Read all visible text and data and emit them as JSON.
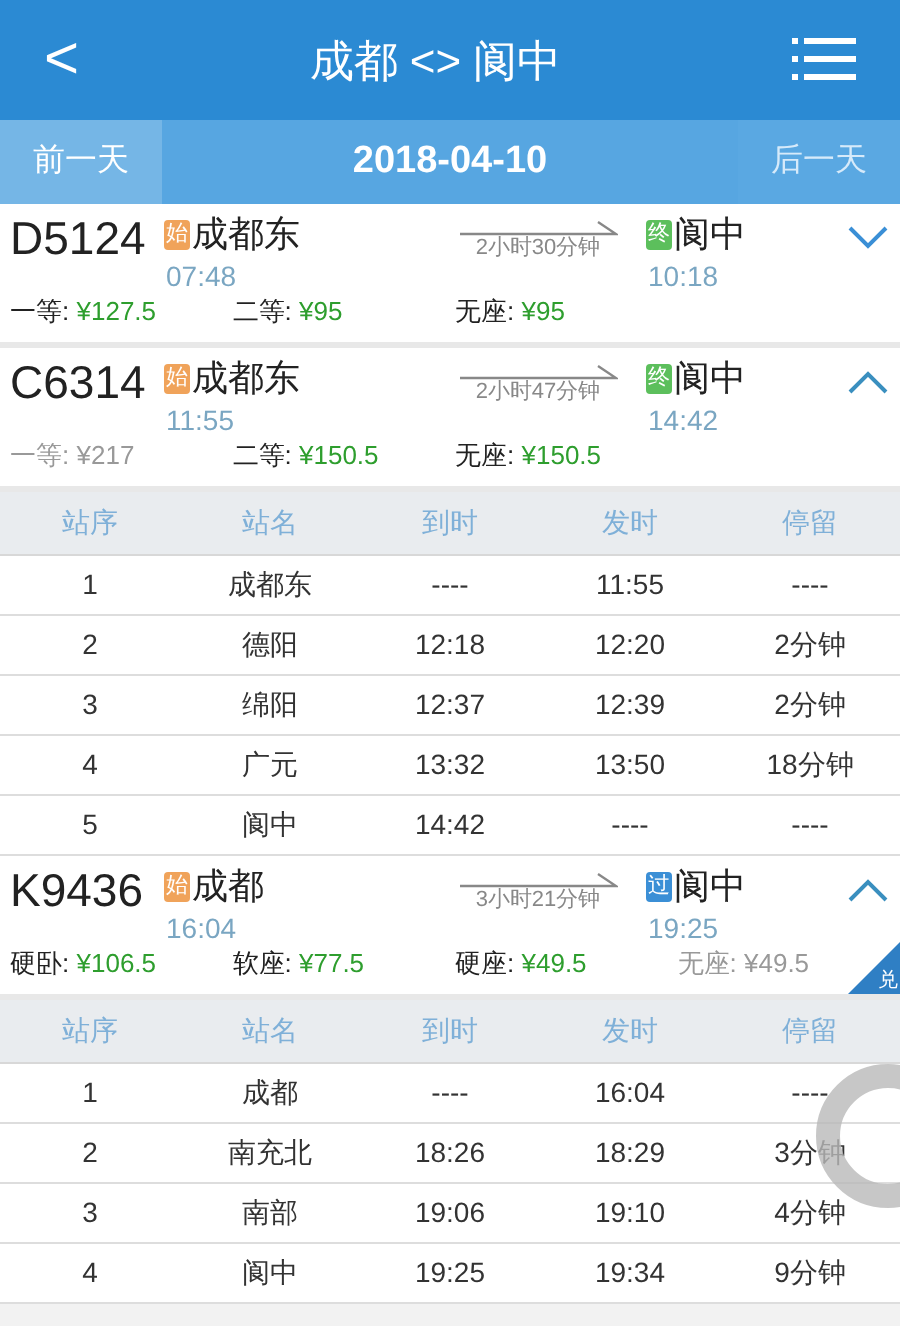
{
  "header": {
    "back": "<",
    "title": "成都 <> 阆中"
  },
  "date_bar": {
    "prev": {
      "label": "前一天",
      "disabled": false
    },
    "date": "2018-04-10",
    "next": {
      "label": "后一天",
      "disabled": true
    }
  },
  "trains": [
    {
      "code": "D5124",
      "from": {
        "badge": "始",
        "color": "#f0a35a",
        "station": "成都东",
        "time": "07:48"
      },
      "duration": "2小时30分钟",
      "to": {
        "badge": "终",
        "color": "#5cbf5c",
        "station": "阆中",
        "time": "10:18"
      },
      "expanded": false,
      "prices": [
        {
          "label": "一等:",
          "price": "¥127.5",
          "available": true
        },
        {
          "label": "二等:",
          "price": "¥95",
          "available": true
        },
        {
          "label": "无座:",
          "price": "¥95",
          "available": true
        }
      ]
    },
    {
      "code": "C6314",
      "from": {
        "badge": "始",
        "color": "#f0a35a",
        "station": "成都东",
        "time": "11:55"
      },
      "duration": "2小时47分钟",
      "to": {
        "badge": "终",
        "color": "#5cbf5c",
        "station": "阆中",
        "time": "14:42"
      },
      "expanded": true,
      "prices": [
        {
          "label": "一等:",
          "price": "¥217",
          "available": false
        },
        {
          "label": "二等:",
          "price": "¥150.5",
          "available": true
        },
        {
          "label": "无座:",
          "price": "¥150.5",
          "available": true
        }
      ],
      "stops": {
        "columns": [
          "站序",
          "站名",
          "到时",
          "发时",
          "停留"
        ],
        "rows": [
          [
            "1",
            "成都东",
            "----",
            "11:55",
            "----"
          ],
          [
            "2",
            "德阳",
            "12:18",
            "12:20",
            "2分钟"
          ],
          [
            "3",
            "绵阳",
            "12:37",
            "12:39",
            "2分钟"
          ],
          [
            "4",
            "广元",
            "13:32",
            "13:50",
            "18分钟"
          ],
          [
            "5",
            "阆中",
            "14:42",
            "----",
            "----"
          ]
        ]
      }
    },
    {
      "code": "K9436",
      "from": {
        "badge": "始",
        "color": "#f0a35a",
        "station": "成都",
        "time": "16:04"
      },
      "duration": "3小时21分钟",
      "to": {
        "badge": "过",
        "color": "#3b8fd6",
        "station": "阆中",
        "time": "19:25"
      },
      "expanded": true,
      "corner_badge": "兑",
      "prices": [
        {
          "label": "硬卧:",
          "price": "¥106.5",
          "available": true
        },
        {
          "label": "软座:",
          "price": "¥77.5",
          "available": true
        },
        {
          "label": "硬座:",
          "price": "¥49.5",
          "available": true
        },
        {
          "label": "无座:",
          "price": "¥49.5",
          "available": false
        }
      ],
      "stops": {
        "columns": [
          "站序",
          "站名",
          "到时",
          "发时",
          "停留"
        ],
        "rows": [
          [
            "1",
            "成都",
            "----",
            "16:04",
            "----"
          ],
          [
            "2",
            "南充北",
            "18:26",
            "18:29",
            "3分钟"
          ],
          [
            "3",
            "南部",
            "19:06",
            "19:10",
            "4分钟"
          ],
          [
            "4",
            "阆中",
            "19:25",
            "19:34",
            "9分钟"
          ]
        ]
      }
    }
  ]
}
